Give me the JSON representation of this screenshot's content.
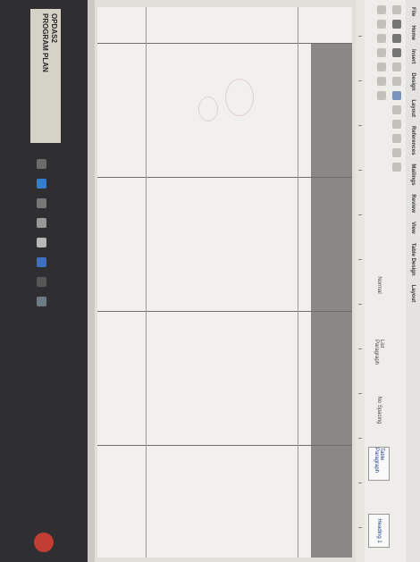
{
  "ribbon": {
    "tabs": [
      "File",
      "Home",
      "Insert",
      "Design",
      "Layout",
      "References",
      "Mailings",
      "Review",
      "View",
      "Table Design",
      "Layout"
    ],
    "style_labels": [
      "Heading 1",
      "Table Paragraph",
      "No Spacing",
      "List Paragraph",
      "Normal"
    ]
  },
  "table": {
    "headers": [
      "",
      "",
      "",
      ""
    ],
    "subheaders": [
      "",
      "",
      ""
    ]
  },
  "taskbar": {
    "folder_title": "OPDAS2",
    "folder_subtitle": "PROGRAM PLAN",
    "search_label": "",
    "tray_text": ""
  },
  "colors": {
    "taskbar": "#2b2a2c",
    "table_header": "#8a8886",
    "start_button": "#c63a2f"
  }
}
